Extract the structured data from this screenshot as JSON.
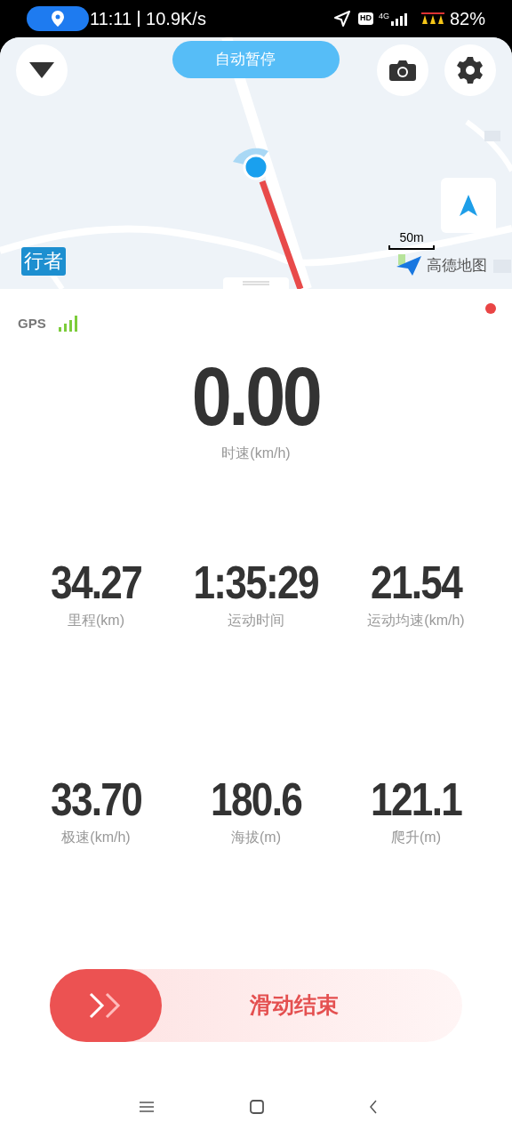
{
  "status_bar": {
    "time": "11:11",
    "speed": "10.9K/s",
    "hd": "HD",
    "network": "4G",
    "battery": "82%"
  },
  "map": {
    "auto_pause": "自动暂停",
    "brand_badge": "行者",
    "scale": "50m",
    "provider": "高德地图"
  },
  "gps": {
    "label": "GPS"
  },
  "speed": {
    "value": "0.00",
    "label": "时速(km/h)"
  },
  "metrics": [
    {
      "value": "34.27",
      "label": "里程(km)"
    },
    {
      "value": "1:35:29",
      "label": "运动时间"
    },
    {
      "value": "21.54",
      "label": "运动均速(km/h)"
    },
    {
      "value": "33.70",
      "label": "极速(km/h)"
    },
    {
      "value": "180.6",
      "label": "海拔(m)"
    },
    {
      "value": "121.1",
      "label": "爬升(m)"
    }
  ],
  "slider": {
    "label": "滑动结束",
    "level": 0
  }
}
